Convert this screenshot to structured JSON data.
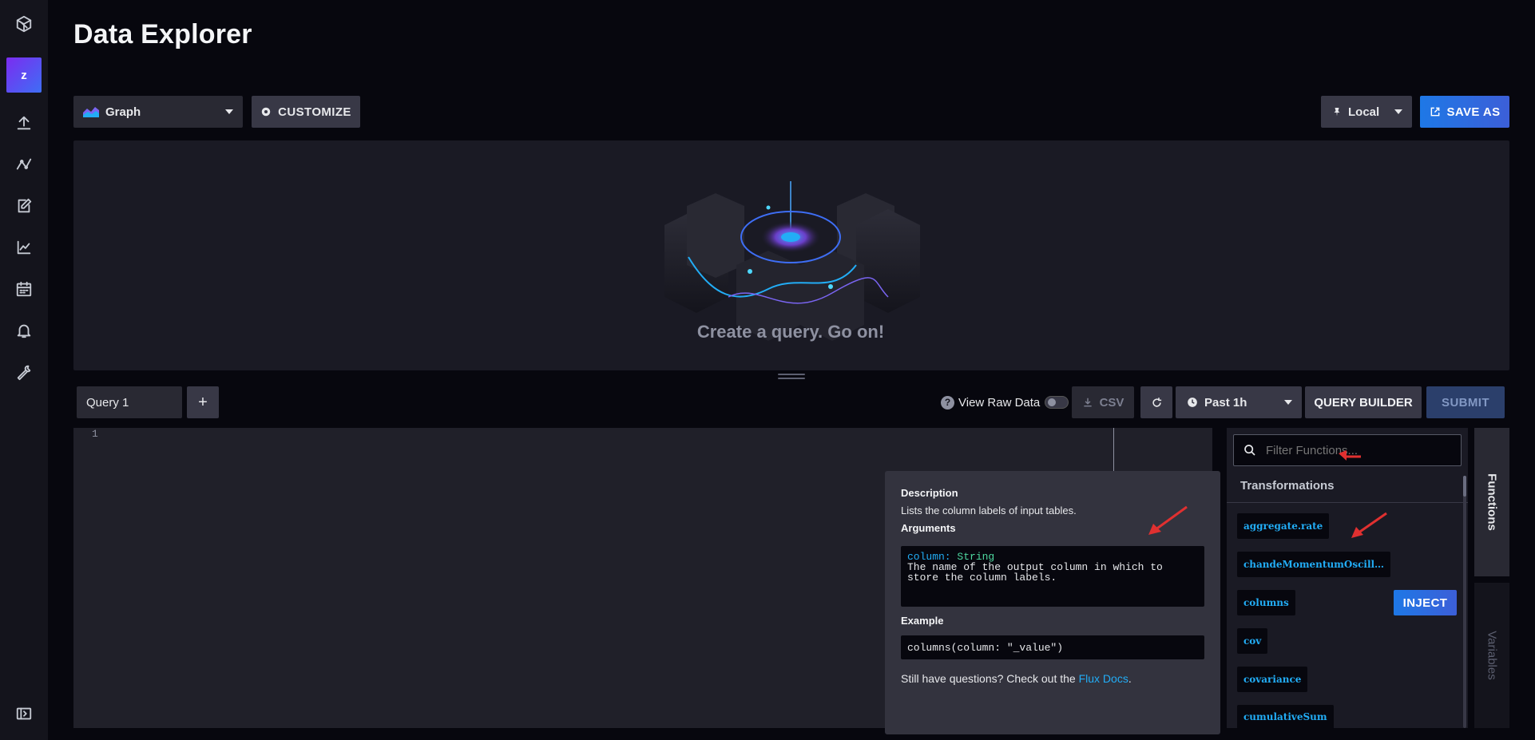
{
  "header": {
    "title": "Data Explorer"
  },
  "nav": {
    "org_initial": "z",
    "icons": [
      "influx-logo-icon",
      "upload-icon",
      "flows-icon",
      "notebook-icon",
      "dashboard-graph-icon",
      "calendar-icon",
      "bell-icon",
      "wrench-icon",
      "sidebar-toggle-icon"
    ]
  },
  "toolbar": {
    "view_type": "Graph",
    "customize_label": "CUSTOMIZE",
    "timezone": "Local",
    "save_as_label": "SAVE AS"
  },
  "graph": {
    "empty_message": "Create a query. Go on!"
  },
  "query": {
    "tab_label": "Query 1",
    "add_label": "+",
    "raw_data_label": "View Raw Data",
    "csv_label": "CSV",
    "time_range": "Past 1h",
    "query_builder_label": "QUERY BUILDER",
    "submit_label": "SUBMIT"
  },
  "editor": {
    "line_number": "1"
  },
  "tooltip": {
    "description_heading": "Description",
    "description": "Lists the column labels of input tables.",
    "arguments_heading": "Arguments",
    "arg_name": "column:",
    "arg_type": "String",
    "arg_desc_1": "The name of the output column in which to",
    "arg_desc_2": "store the column labels.",
    "example_heading": "Example",
    "example": "columns(column: \"_value\")",
    "help_text": "Still have questions? Check out the",
    "help_link": "Flux Docs",
    "help_end": "."
  },
  "functions": {
    "filter_placeholder": "Filter Functions...",
    "category": "Transformations",
    "items": [
      "aggregate.rate",
      "chandeMomentumOscill…",
      "columns",
      "cov",
      "covariance",
      "cumulativeSum"
    ],
    "inject_label": "INJECT"
  },
  "side_tabs": {
    "functions": "Functions",
    "variables": "Variables"
  },
  "colors": {
    "accent_blue": "#22adf6",
    "button_gradient_start": "#1e78e6",
    "annotation_red": "#e03030"
  }
}
